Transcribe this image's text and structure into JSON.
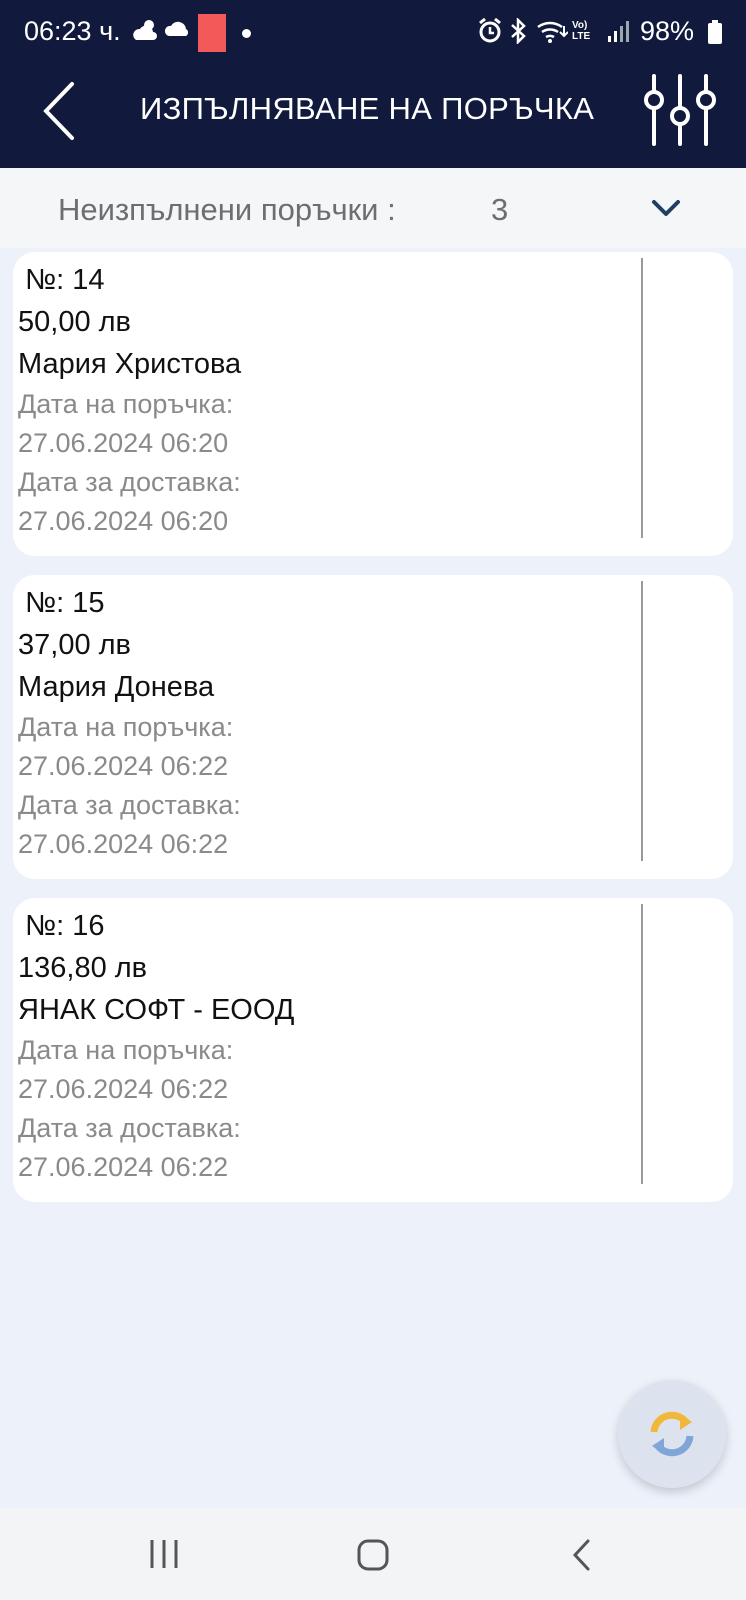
{
  "status_bar": {
    "time": "06:23 ч.",
    "battery": "98%",
    "icons": [
      "weather-icon",
      "cloud-icon",
      "notification-icon",
      "alarm-icon",
      "bluetooth-icon",
      "wifi-icon",
      "volte-icon",
      "signal-icon",
      "battery-icon"
    ]
  },
  "header": {
    "title": "ИЗПЪЛНЯВАНЕ НА ПОРЪЧКА",
    "back_icon": "chevron-left-icon",
    "filter_icon": "sliders-icon"
  },
  "summary": {
    "label": "Неизпълнени поръчки :",
    "count": "3",
    "expand_icon": "chevron-down-icon"
  },
  "orders": [
    {
      "number": "№: 14",
      "amount": "50,00 лв",
      "customer": "Мария Христова",
      "order_date_label": "Дата на поръчка:",
      "order_date": "27.06.2024 06:20",
      "delivery_date_label": "Дата за доставка:",
      "delivery_date": "27.06.2024 06:20"
    },
    {
      "number": "№: 15",
      "amount": "37,00 лв",
      "customer": "Мария Донева",
      "order_date_label": "Дата на поръчка:",
      "order_date": "27.06.2024 06:22",
      "delivery_date_label": "Дата за доставка:",
      "delivery_date": "27.06.2024 06:22"
    },
    {
      "number": "№: 16",
      "amount": "136,80 лв",
      "customer": "ЯНАК СОФТ - ЕООД",
      "order_date_label": "Дата на поръчка:",
      "order_date": "27.06.2024 06:22",
      "delivery_date_label": "Дата за доставка:",
      "delivery_date": "27.06.2024 06:22"
    }
  ],
  "fab": {
    "icon": "refresh-icon"
  },
  "nav": {
    "icons": [
      "recent-apps-icon",
      "home-icon",
      "back-icon"
    ]
  },
  "colors": {
    "header_bg": "#111a3c",
    "page_bg": "#edf1fa",
    "accent": "#1f3f66",
    "refresh_orange": "#f0b73a",
    "refresh_blue": "#7fa6d6"
  }
}
